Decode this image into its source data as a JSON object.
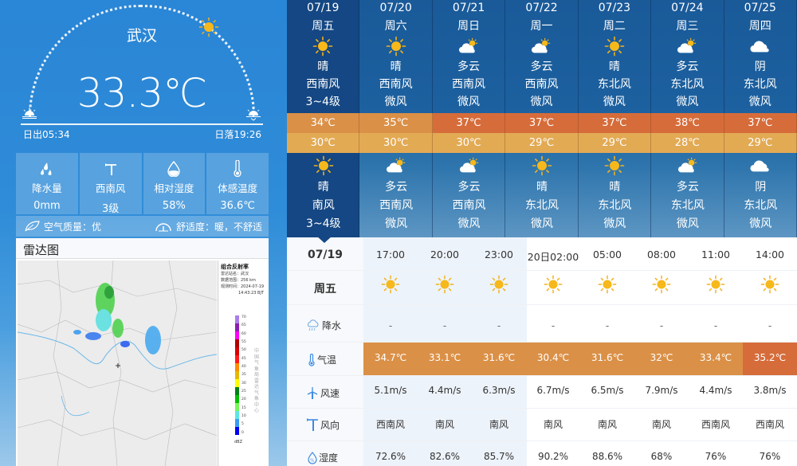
{
  "current": {
    "city": "武汉",
    "temperature": "33.3℃",
    "sunrise": "日出05:34",
    "sunset": "日落19:26",
    "stats": [
      {
        "icon": "rain-drops-icon",
        "label": "降水量",
        "value": "0mm"
      },
      {
        "icon": "wind-vane-icon",
        "label": "西南风",
        "value": "3级"
      },
      {
        "icon": "humidity-drop-icon",
        "label": "相对湿度",
        "value": "58%"
      },
      {
        "icon": "thermometer-icon",
        "label": "体感温度",
        "value": "36.6℃"
      }
    ],
    "air_quality": "空气质量：优",
    "comfort": "舒适度：暖，不舒适"
  },
  "radar": {
    "title": "雷达图",
    "legend_title": "组合反射率",
    "station": "雷达站名：武汉",
    "range": "数据范围：256 km",
    "obs_time_label": "观测时间：2024-07-19",
    "obs_time_value": "14:43:23 BJT",
    "source": "中国气象局雷达气象中心",
    "unit": "dBZ",
    "scale_labels": [
      "70",
      "65",
      "60",
      "55",
      "50",
      "45",
      "40",
      "35",
      "30",
      "25",
      "20",
      "15",
      "10",
      "5",
      "0"
    ],
    "scale_colors": [
      "#a97fe6",
      "#8a1fb0",
      "#ff00ff",
      "#b00000",
      "#d80000",
      "#ff1a1a",
      "#ff8c00",
      "#e6b800",
      "#ffff00",
      "#00801a",
      "#00c000",
      "#7af55a",
      "#5ee5e5",
      "#3a9cf0",
      "#0000f0"
    ]
  },
  "daily": [
    {
      "date": "07/19",
      "week": "周五",
      "day_icon": "sunny-icon",
      "day_weather": "晴",
      "day_wind": "西南风",
      "day_level": "3~4级",
      "high": "34℃",
      "low": "30℃",
      "night_icon": "sunny-icon",
      "night_weather": "晴",
      "night_wind": "南风",
      "night_level": "3~4级",
      "active": true
    },
    {
      "date": "07/20",
      "week": "周六",
      "day_icon": "sunny-icon",
      "day_weather": "晴",
      "day_wind": "西南风",
      "day_level": "微风",
      "high": "35℃",
      "low": "30℃",
      "night_icon": "partly-cloudy-icon",
      "night_weather": "多云",
      "night_wind": "西南风",
      "night_level": "微风"
    },
    {
      "date": "07/21",
      "week": "周日",
      "day_icon": "partly-cloudy-icon",
      "day_weather": "多云",
      "day_wind": "西南风",
      "day_level": "微风",
      "high": "37℃",
      "low": "30℃",
      "night_icon": "partly-cloudy-icon",
      "night_weather": "多云",
      "night_wind": "西南风",
      "night_level": "微风"
    },
    {
      "date": "07/22",
      "week": "周一",
      "day_icon": "partly-cloudy-icon",
      "day_weather": "多云",
      "day_wind": "西南风",
      "day_level": "微风",
      "high": "37℃",
      "low": "29℃",
      "night_icon": "sunny-icon",
      "night_weather": "晴",
      "night_wind": "东北风",
      "night_level": "微风"
    },
    {
      "date": "07/23",
      "week": "周二",
      "day_icon": "sunny-icon",
      "day_weather": "晴",
      "day_wind": "东北风",
      "day_level": "微风",
      "high": "37℃",
      "low": "29℃",
      "night_icon": "sunny-icon",
      "night_weather": "晴",
      "night_wind": "东北风",
      "night_level": "微风"
    },
    {
      "date": "07/24",
      "week": "周三",
      "day_icon": "partly-cloudy-icon",
      "day_weather": "多云",
      "day_wind": "东北风",
      "day_level": "微风",
      "high": "38℃",
      "low": "28℃",
      "night_icon": "partly-cloudy-icon",
      "night_weather": "多云",
      "night_wind": "东北风",
      "night_level": "微风"
    },
    {
      "date": "07/25",
      "week": "周四",
      "day_icon": "cloudy-icon",
      "day_weather": "阴",
      "day_wind": "东北风",
      "day_level": "微风",
      "high": "37℃",
      "low": "29℃",
      "night_icon": "cloudy-icon",
      "night_weather": "阴",
      "night_wind": "东北风",
      "night_level": "微风"
    }
  ],
  "band_colors": {
    "warm": "#db9047",
    "hot": "#d66c3a",
    "low": "#e3aa54"
  },
  "hourly": {
    "date": "07/19",
    "week": "周五",
    "row_labels": {
      "rain": "降水",
      "temp": "气温",
      "speed": "风速",
      "dir": "风向",
      "hum": "湿度"
    },
    "slots": [
      {
        "time": "17:00",
        "icon": "sunny-icon",
        "rain": "-",
        "temp": "34.7℃",
        "speed": "5.1m/s",
        "dir": "西南风",
        "hum": "72.6%"
      },
      {
        "time": "20:00",
        "icon": "sunny-icon",
        "rain": "-",
        "temp": "33.1℃",
        "speed": "4.4m/s",
        "dir": "南风",
        "hum": "82.6%"
      },
      {
        "time": "23:00",
        "icon": "sunny-icon",
        "rain": "-",
        "temp": "31.6℃",
        "speed": "6.3m/s",
        "dir": "南风",
        "hum": "85.7%"
      },
      {
        "time": "20日02:00",
        "icon": "sunny-icon",
        "rain": "-",
        "temp": "30.4℃",
        "speed": "6.7m/s",
        "dir": "南风",
        "hum": "90.2%"
      },
      {
        "time": "05:00",
        "icon": "sunny-icon",
        "rain": "-",
        "temp": "31.6℃",
        "speed": "6.5m/s",
        "dir": "南风",
        "hum": "88.6%"
      },
      {
        "time": "08:00",
        "icon": "sunny-icon",
        "rain": "-",
        "temp": "32℃",
        "speed": "7.9m/s",
        "dir": "南风",
        "hum": "68%"
      },
      {
        "time": "11:00",
        "icon": "sunny-icon",
        "rain": "-",
        "temp": "33.4℃",
        "speed": "4.4m/s",
        "dir": "西南风",
        "hum": "76%"
      },
      {
        "time": "14:00",
        "icon": "sunny-icon",
        "rain": "-",
        "temp": "35.2℃",
        "speed": "3.8m/s",
        "dir": "西南风",
        "hum": "76%"
      }
    ]
  }
}
